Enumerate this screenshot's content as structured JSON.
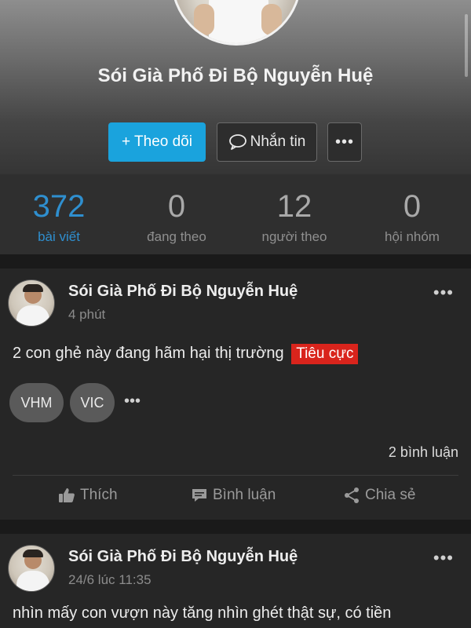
{
  "profile": {
    "name": "Sói Già Phố Đi Bộ Nguyễn Huệ",
    "buttons": {
      "follow": "+ Theo dõi",
      "message": "Nhắn tin",
      "more": "•••"
    }
  },
  "stats": [
    {
      "value": "372",
      "label": "bài viết",
      "active": true
    },
    {
      "value": "0",
      "label": "đang theo",
      "active": false
    },
    {
      "value": "12",
      "label": "người theo",
      "active": false
    },
    {
      "value": "0",
      "label": "hội nhóm",
      "active": false
    }
  ],
  "posts": [
    {
      "author": "Sói Già Phố Đi Bộ Nguyễn Huệ",
      "time": "4 phút",
      "menu": "•••",
      "text": "2 con ghẻ này đang hãm hại thị trường",
      "sentiment": "Tiêu cực",
      "tickers": [
        "VHM",
        "VIC"
      ],
      "tickers_more": "•••",
      "comments": "2 bình luận",
      "actions": {
        "like": "Thích",
        "comment": "Bình luận",
        "share": "Chia sẻ"
      }
    },
    {
      "author": "Sói Già Phố Đi Bộ Nguyễn Huệ",
      "time": "24/6 lúc 11:35",
      "menu": "•••",
      "text": "nhìn mấy con vượn này tăng nhìn ghét thật sự, có tiền"
    }
  ],
  "colors": {
    "accent": "#1aa3dd",
    "active_stat": "#2f8fcf",
    "negative_tag": "#d9241c"
  },
  "icons": [
    "chat-bubble-icon",
    "thumbs-up-icon",
    "comment-icon",
    "share-icon",
    "more-dots-icon"
  ]
}
